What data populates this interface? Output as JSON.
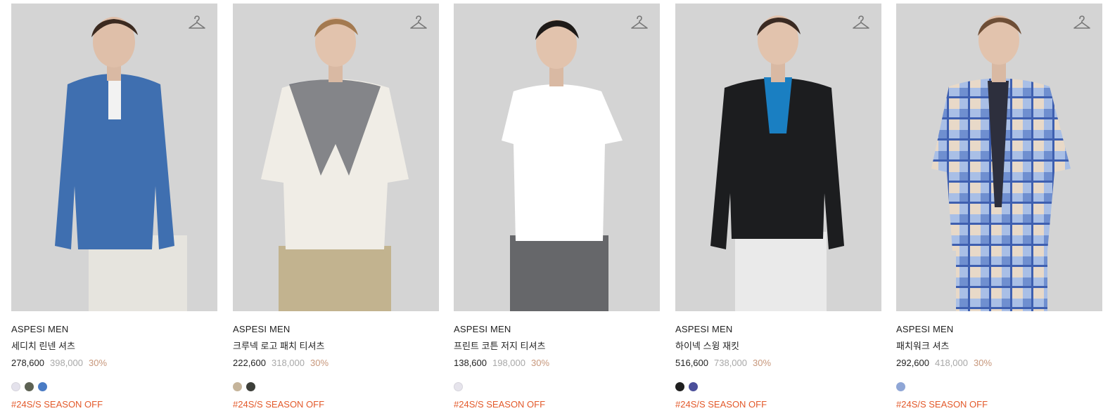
{
  "products": [
    {
      "brand": "ASPESI MEN",
      "name": "세디치 린넨 셔츠",
      "sale_price": "278,600",
      "original_price": "398,000",
      "discount": "30%",
      "swatches": [
        "#e4e2ec",
        "#5d6253",
        "#4a7bc4"
      ],
      "tag": "#24S/S SEASON OFF",
      "image": {
        "top": "#3f6fb0",
        "bottom": "#e6e4de",
        "inner": "#f2f2f2"
      }
    },
    {
      "brand": "ASPESI MEN",
      "name": "크루넥 로고 패치 티셔츠",
      "sale_price": "222,600",
      "original_price": "318,000",
      "discount": "30%",
      "swatches": [
        "#c5b49a",
        "#3d3f3a"
      ],
      "tag": "#24S/S SEASON OFF",
      "image": {
        "top": "#f0ede6",
        "bottom": "#c2b38f",
        "inner": "#f0ede6"
      }
    },
    {
      "brand": "ASPESI MEN",
      "name": "프린트 코튼 저지 티셔츠",
      "sale_price": "138,600",
      "original_price": "198,000",
      "discount": "30%",
      "swatches": [
        "#e6e4ec"
      ],
      "tag": "#24S/S SEASON OFF",
      "image": {
        "top": "#ffffff",
        "bottom": "#66676a",
        "inner": "#ffffff"
      }
    },
    {
      "brand": "ASPESI MEN",
      "name": "하이넥 스윙 재킷",
      "sale_price": "516,600",
      "original_price": "738,000",
      "discount": "30%",
      "swatches": [
        "#1f1f1f",
        "#4b4f9a"
      ],
      "tag": "#24S/S SEASON OFF",
      "image": {
        "top": "#1c1d1f",
        "bottom": "#eaeaea",
        "inner": "#1a7fc2"
      }
    },
    {
      "brand": "ASPESI MEN",
      "name": "패치워크 셔츠",
      "sale_price": "292,600",
      "original_price": "418,000",
      "discount": "30%",
      "swatches": [
        "#8fa6d6"
      ],
      "tag": "#24S/S SEASON OFF",
      "image": {
        "top": "#93aee0",
        "bottom": "#a9bfe6",
        "inner": "#2d2f3d"
      }
    }
  ]
}
